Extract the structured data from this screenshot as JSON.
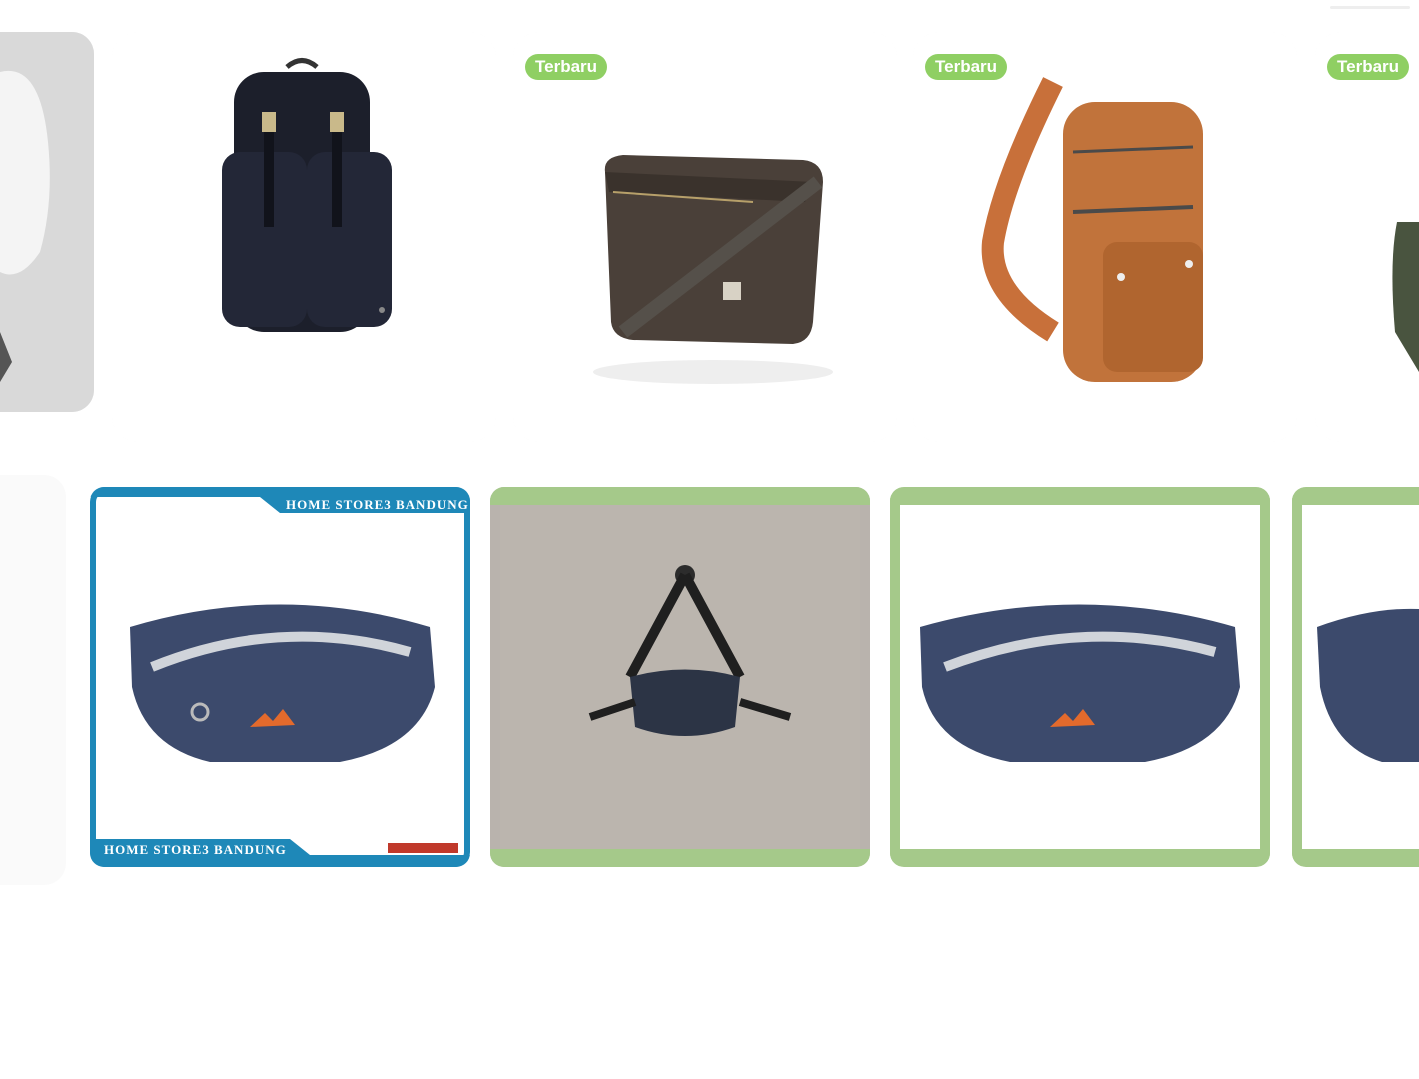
{
  "colors": {
    "badge": "#8fcf63",
    "card_bg": "#fafafa",
    "frame_blue": "#1e88b8",
    "frame_green": "#a5c98a"
  },
  "row1": [
    {
      "name": "partial-white-product",
      "badge": ""
    },
    {
      "name": "black-backpack",
      "badge": ""
    },
    {
      "name": "brown-messenger-bag",
      "badge": "Terbaru"
    },
    {
      "name": "orange-sling-bag",
      "badge": "Terbaru"
    },
    {
      "name": "green-bag-partial",
      "badge": "Terbaru"
    }
  ],
  "row2": [
    {
      "name": "navy-waist-bag-blue-frame",
      "frame_top": "HOME STORE3 BANDUNG",
      "frame_bottom": "HOME STORE3 BANDUNG"
    },
    {
      "name": "black-waist-bag-on-hook",
      "frame_top": "",
      "frame_bottom": ""
    },
    {
      "name": "navy-waist-bag-green-frame",
      "frame_top": "",
      "frame_bottom": ""
    },
    {
      "name": "navy-waist-bag-partial",
      "frame_top": "",
      "frame_bottom": ""
    }
  ]
}
